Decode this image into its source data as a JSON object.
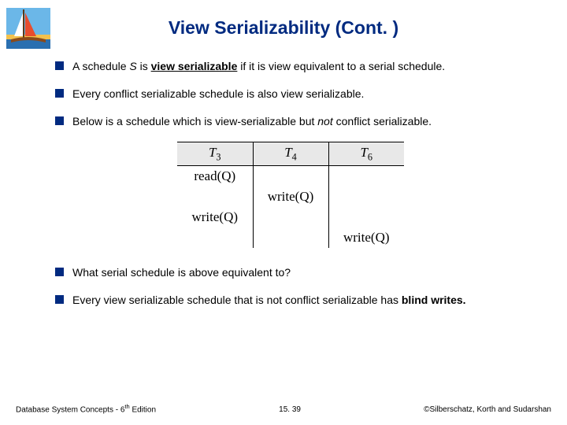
{
  "title": "View Serializability (Cont. )",
  "bullets": {
    "b1_pre": "A schedule ",
    "b1_S": "S",
    "b1_mid": " is ",
    "b1_term": "view serializable",
    "b1_post": " if it is view equivalent to a serial schedule.",
    "b2": "Every conflict serializable schedule is also view serializable.",
    "b3_pre": "Below is a schedule which is view-serializable but ",
    "b3_not": "not",
    "b3_post": " conflict serializable.",
    "b4": "What serial schedule is above equivalent to?",
    "b5_pre": "Every view serializable schedule that is not conflict serializable has ",
    "b5_term": "blind writes."
  },
  "schedule": {
    "headers": [
      "T",
      "T",
      "T"
    ],
    "header_subs": [
      "3",
      "4",
      "6"
    ],
    "rows": [
      [
        "read(Q)",
        "",
        ""
      ],
      [
        "",
        "write(Q)",
        ""
      ],
      [
        "write(Q)",
        "",
        ""
      ],
      [
        "",
        "",
        "write(Q)"
      ]
    ]
  },
  "footer": {
    "left_pre": "Database System Concepts - 6",
    "left_sup": "th",
    "left_post": " Edition",
    "center": "15. 39",
    "right": "©Silberschatz, Korth and Sudarshan"
  }
}
